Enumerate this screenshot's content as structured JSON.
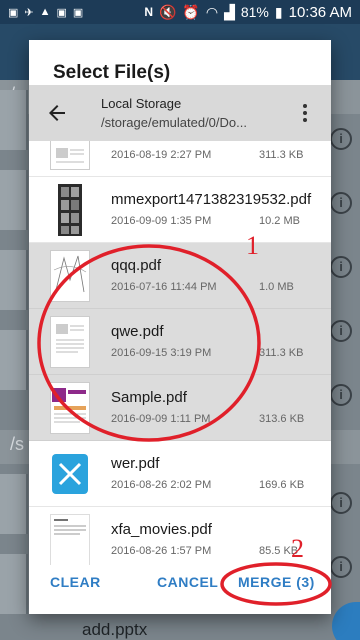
{
  "status_bar": {
    "battery": "81%",
    "time": "10:36 AM"
  },
  "background": {
    "path_label": "/s",
    "path_label2": "/s",
    "bottom_file": "add.pptx"
  },
  "dialog": {
    "title": "Select File(s)",
    "location": {
      "title": "Local Storage",
      "path": "/storage/emulated/0/Do..."
    },
    "files": [
      {
        "name": "",
        "date": "2016-08-19 2:27 PM",
        "size": "311.3 KB",
        "selected": false,
        "thumb": "doc"
      },
      {
        "name": "mmexport1471382319532.pdf",
        "date": "2016-09-09 1:35 PM",
        "size": "10.2 MB",
        "selected": false,
        "thumb": "photo"
      },
      {
        "name": "qqq.pdf",
        "date": "2016-07-16 11:44 PM",
        "size": "1.0 MB",
        "selected": true,
        "thumb": "sketch"
      },
      {
        "name": "qwe.pdf",
        "date": "2016-09-15 3:19 PM",
        "size": "311.3 KB",
        "selected": true,
        "thumb": "doc"
      },
      {
        "name": "Sample.pdf",
        "date": "2016-09-09 1:11 PM",
        "size": "313.6 KB",
        "selected": true,
        "thumb": "sample"
      },
      {
        "name": "wer.pdf",
        "date": "2016-08-26 2:02 PM",
        "size": "169.6 KB",
        "selected": false,
        "thumb": "app"
      },
      {
        "name": "xfa_movies.pdf",
        "date": "2016-08-26 1:57 PM",
        "size": "85.5 KB",
        "selected": false,
        "thumb": "text"
      }
    ],
    "actions": {
      "clear": "CLEAR",
      "cancel": "CANCEL",
      "merge": "MERGE (3)"
    }
  },
  "annotations": {
    "label1": "1",
    "label2": "2",
    "color": "#e0202a"
  },
  "colors": {
    "accent": "#2f7dc4",
    "selected_row": "#dcdcdc",
    "status_bar": "#1d3b57"
  }
}
